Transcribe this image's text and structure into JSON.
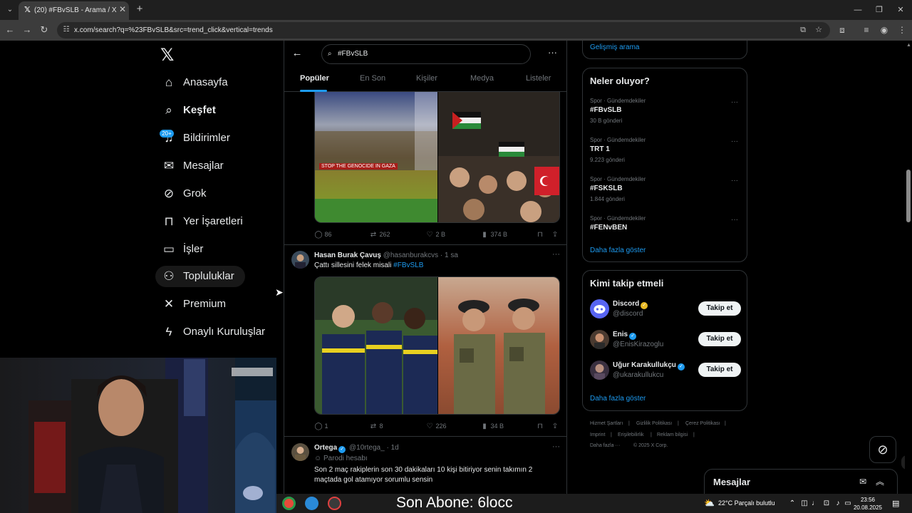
{
  "browser": {
    "tab_title": "(20) #FBvSLB - Arama / X",
    "url": "x.com/search?q=%23FBvSLB&src=trend_click&vertical=trends"
  },
  "nav": {
    "badge": "20+",
    "items": [
      {
        "label": "Anasayfa",
        "icon": "home-icon"
      },
      {
        "label": "Keşfet",
        "icon": "search-icon"
      },
      {
        "label": "Bildirimler",
        "icon": "bell-icon"
      },
      {
        "label": "Mesajlar",
        "icon": "mail-icon"
      },
      {
        "label": "Grok",
        "icon": "grok-icon"
      },
      {
        "label": "Yer İşaretleri",
        "icon": "bookmark-icon"
      },
      {
        "label": "İşler",
        "icon": "briefcase-icon"
      },
      {
        "label": "Topluluklar",
        "icon": "people-icon"
      },
      {
        "label": "Premium",
        "icon": "x-logo-icon"
      },
      {
        "label": "Onaylı Kuruluşlar",
        "icon": "lightning-icon"
      }
    ]
  },
  "search": {
    "query": "#FBvSLB",
    "tabs": [
      "Popüler",
      "En Son",
      "Kişiler",
      "Medya",
      "Listeler"
    ]
  },
  "tweets": [
    {
      "replies": "86",
      "reposts": "262",
      "likes": "2 B",
      "views": "374 B",
      "image_banner": "STOP THE GENOCIDE IN GAZA"
    },
    {
      "name": "Hasan Burak Çavuş",
      "handle": "@hasanburakcvs",
      "time": "1 sa",
      "text": "Çattı sillesini felek misali",
      "hashtag": "#FBvSLB",
      "replies": "1",
      "reposts": "8",
      "likes": "226",
      "views": "34 B"
    },
    {
      "name": "Ortega",
      "handle": "@10rtega_",
      "time": "1d",
      "label": "Parodi hesabı",
      "text": "Son 2 maç rakiplerin son 30 dakikaları 10 kişi bitiriyor senin takımın 2 maçtada gol atamıyor sorumlu sensin"
    }
  ],
  "right": {
    "advanced_search": "Gelişmiş arama",
    "trends_title": "Neler oluyor?",
    "trends": [
      {
        "category": "Spor · Gündemdekiler",
        "name": "#FBvSLB",
        "count": "30 B gönderi"
      },
      {
        "category": "Spor · Gündemdekiler",
        "name": "TRT 1",
        "count": "9.223 gönderi"
      },
      {
        "category": "Spor · Gündemdekiler",
        "name": "#FSKSLB",
        "count": "1.844 gönderi"
      },
      {
        "category": "Spor · Gündemdekiler",
        "name": "#FENvBEN",
        "count": ""
      }
    ],
    "show_more": "Daha fazla göster",
    "follow_title": "Kimi takip etmeli",
    "follow": [
      {
        "name": "Discord",
        "handle": "@discord",
        "button": "Takip et"
      },
      {
        "name": "Enis",
        "handle": "@EnisKirazoglu",
        "button": "Takip et"
      },
      {
        "name": "Uğur Karakullukçu",
        "handle": "@ukarakullukcu",
        "button": "Takip et"
      }
    ],
    "show_more_2": "Daha fazla göster",
    "footer": [
      "Hizmet Şartları",
      "Gizlilik Politikası",
      "Çerez Politikası",
      "Imprint",
      "Erişilebilirlik",
      "Reklam bilgisi",
      "Daha fazla ···",
      "© 2025 X Corp."
    ]
  },
  "messages_dock": "Mesajlar",
  "stream_overlay": "Son Abone: 6locc",
  "taskbar": {
    "weather": "22°C  Parçalı bulutlu",
    "time": "23:56",
    "date": "20.08.2025"
  },
  "colors": {
    "accent": "#1d9bf0",
    "background": "#000000",
    "border": "#2f3336",
    "muted": "#71767b"
  }
}
